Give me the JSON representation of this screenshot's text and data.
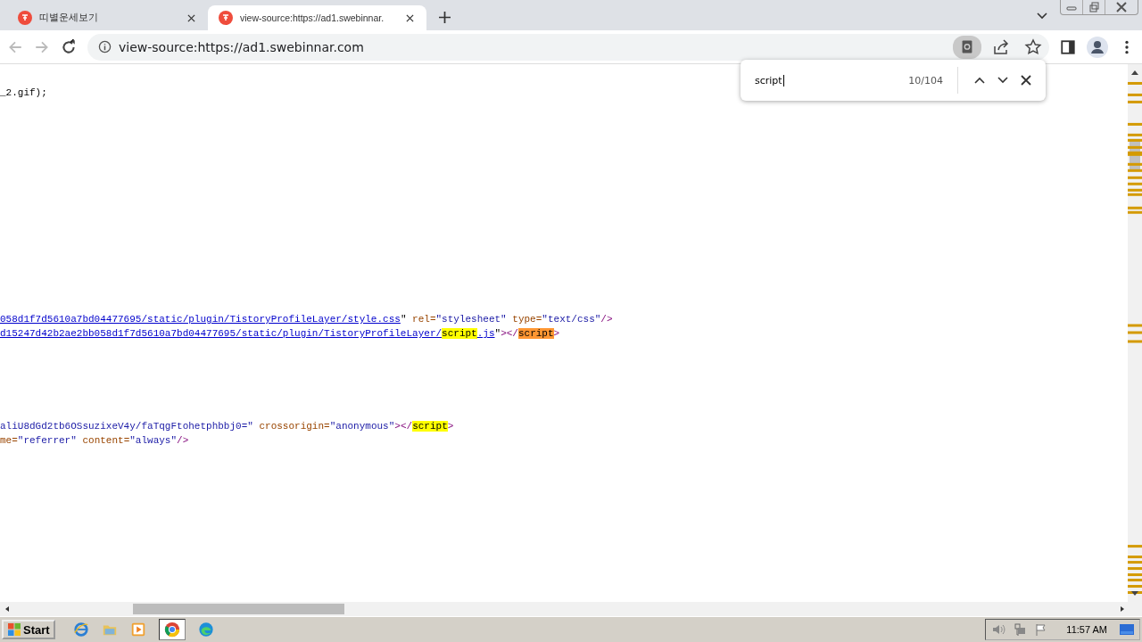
{
  "tabs": [
    {
      "title": "띠별운세보기",
      "selected": false
    },
    {
      "title": "view-source:https://ad1.swebinnar.",
      "selected": true
    }
  ],
  "address_bar": {
    "url": "view-source:https://ad1.swebinnar.com"
  },
  "find_bar": {
    "query": "script",
    "count": "10/104"
  },
  "source_lines": [
    {
      "segments": [
        {
          "kind": "text",
          "text": "_2.gif);"
        }
      ]
    },
    {
      "segments": [
        {
          "kind": "link",
          "text": "058d1f7d5610a7bd04477695/static/plugin/TistoryProfileLayer/style.css"
        },
        {
          "kind": "text",
          "text": "\""
        },
        {
          "kind": "attr",
          "text": " rel="
        },
        {
          "kind": "value",
          "text": "\"stylesheet\""
        },
        {
          "kind": "attr",
          "text": " type="
        },
        {
          "kind": "value",
          "text": "\"text/css\""
        },
        {
          "kind": "tag",
          "text": "/>"
        }
      ]
    },
    {
      "segments": [
        {
          "kind": "link",
          "text": "d15247d42b2ae2bb058d1f7d5610a7bd04477695/static/plugin/TistoryProfileLayer/"
        },
        {
          "kind": "match",
          "text": "script",
          "selected": false
        },
        {
          "kind": "link",
          "text": ".js"
        },
        {
          "kind": "text",
          "text": "\""
        },
        {
          "kind": "tag",
          "text": "></"
        },
        {
          "kind": "match",
          "text": "script",
          "selected": true
        },
        {
          "kind": "tag",
          "text": ">"
        }
      ]
    },
    {
      "segments": [
        {
          "kind": "value",
          "text": "aliU8dGd2tb6OSsuzixeV4y/faTqgFtohetphbbj0=\""
        },
        {
          "kind": "attr",
          "text": " crossorigin="
        },
        {
          "kind": "value",
          "text": "\"anonymous\""
        },
        {
          "kind": "tag",
          "text": "></"
        },
        {
          "kind": "match",
          "text": "script",
          "selected": false
        },
        {
          "kind": "tag",
          "text": ">"
        }
      ]
    },
    {
      "segments": [
        {
          "kind": "attr",
          "text": "me="
        },
        {
          "kind": "value",
          "text": "\"referrer\""
        },
        {
          "kind": "attr",
          "text": " content="
        },
        {
          "kind": "value",
          "text": "\"always\""
        },
        {
          "kind": "tag",
          "text": "/>"
        }
      ]
    }
  ],
  "taskbar": {
    "start_label": "Start",
    "clock": "11:57 AM"
  }
}
